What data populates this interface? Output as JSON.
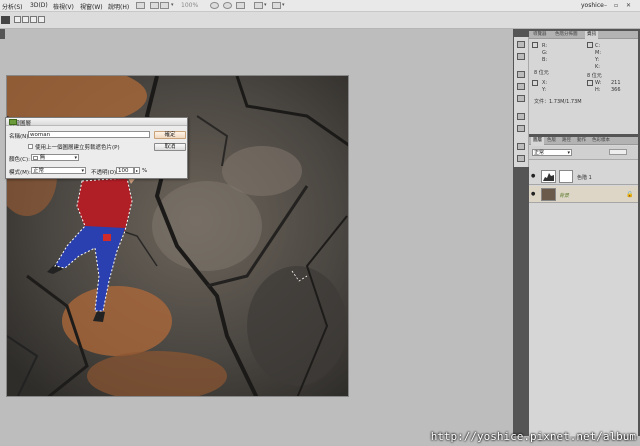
{
  "menu": {
    "items": [
      "分析(S)",
      "3D(D)",
      "檢視(V)",
      "視窗(W)",
      "說明(H)"
    ],
    "user": "yoshice",
    "zoom_value": "100%"
  },
  "options_bar": {
    "tool_icon": "marquee-tool-icon"
  },
  "dialog": {
    "title": "新增圖層",
    "name_label": "名稱(N):",
    "name_value": "woman",
    "clip_checkbox_label": "使用上一個圖層建立剪裁遮色片(P)",
    "color_label": "顏色(C):",
    "color_value": "無",
    "mode_label": "模式(M):",
    "mode_value": "正常",
    "opacity_label": "不透明(O):",
    "opacity_value": "100",
    "opacity_unit": "%",
    "ok_label": "確定",
    "cancel_label": "取消"
  },
  "info_panel": {
    "tabs": [
      "導覽器",
      "色階分佈圖",
      "資訊"
    ],
    "active_tab": "資訊",
    "rgb_labels": [
      "R:",
      "G:",
      "B:"
    ],
    "cmyk_labels": [
      "C:",
      "M:",
      "Y:",
      "K:"
    ],
    "bit_left": "8 位元",
    "bit_right": "8 位元",
    "x_label": "X:",
    "y_label": "Y:",
    "w_label": "W:",
    "h_label": "H:",
    "w_value": "211",
    "h_value": "366",
    "doc_size": "文件：1.73M/1.73M"
  },
  "layers_panel": {
    "tabs": [
      "圖層",
      "色版",
      "路徑",
      "動作",
      "色彩樣本"
    ],
    "active_tab": "圖層",
    "blend_mode": "正常",
    "layers": [
      {
        "name": "色階 1"
      },
      {
        "name": "背景"
      }
    ]
  },
  "watermark": "http://yoshice.pixnet.net/album"
}
